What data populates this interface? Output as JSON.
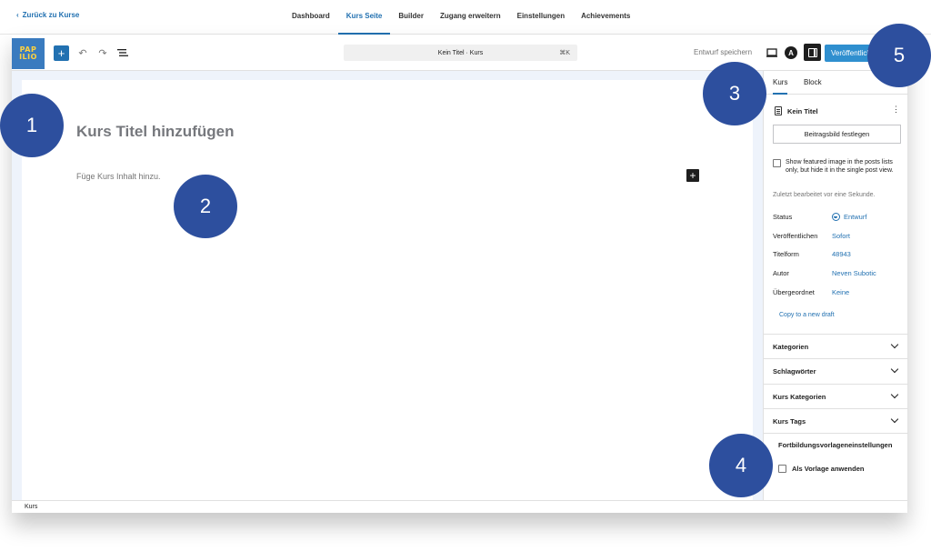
{
  "topnav": {
    "back_label": "Zurück zu Kurse",
    "tabs": [
      {
        "label": "Dashboard"
      },
      {
        "label": "Kurs Seite"
      },
      {
        "label": "Builder"
      },
      {
        "label": "Zugang erweitern"
      },
      {
        "label": "Einstellungen"
      },
      {
        "label": "Achievements"
      }
    ],
    "active_tab": "Kurs Seite"
  },
  "logo": {
    "line1": "PAP",
    "line2": "ILIO"
  },
  "toolbar": {
    "command_bar_text": "Kein Titel · Kurs",
    "command_shortcut": "⌘K",
    "save_draft_label": "Entwurf speichern",
    "publish_label": "Veröffentlichen"
  },
  "editor": {
    "title_placeholder": "Kurs Titel hinzufügen",
    "content_placeholder": "Füge Kurs Inhalt hinzu."
  },
  "footer": {
    "breadcrumb": "Kurs"
  },
  "sidebar": {
    "tabs": [
      {
        "label": "Kurs"
      },
      {
        "label": "Block"
      }
    ],
    "post_title": "Kein Titel",
    "featured_image_button": "Beitragsbild festlegen",
    "featured_checkbox_text": "Show featured image in the posts lists only, but hide it in the single post view.",
    "last_edited": "Zuletzt bearbeitet vor eine Sekunde.",
    "properties": [
      {
        "label": "Status",
        "value": "Entwurf"
      },
      {
        "label": "Veröffentlichen",
        "value": "Sofort"
      },
      {
        "label": "Titelform",
        "value": "48943"
      },
      {
        "label": "Autor",
        "value": "Neven Subotic"
      },
      {
        "label": "Übergeordnet",
        "value": "Keine"
      }
    ],
    "copy_draft_link": "Copy to a new draft",
    "panels": [
      {
        "label": "Kategorien"
      },
      {
        "label": "Schlagwörter"
      },
      {
        "label": "Kurs Kategorien"
      },
      {
        "label": "Kurs Tags"
      }
    ],
    "template_settings_title": "Fortbildungsvorlageneinstellungen",
    "template_checkbox_label": "Als Vorlage anwenden"
  },
  "callouts": [
    {
      "number": "1"
    },
    {
      "number": "2"
    },
    {
      "number": "3"
    },
    {
      "number": "4"
    },
    {
      "number": "5"
    }
  ],
  "colors": {
    "accent": "#2271b1",
    "callout": "#2d4f9e",
    "logo_bg": "#3a7bbf",
    "logo_text": "#ffd23f"
  }
}
